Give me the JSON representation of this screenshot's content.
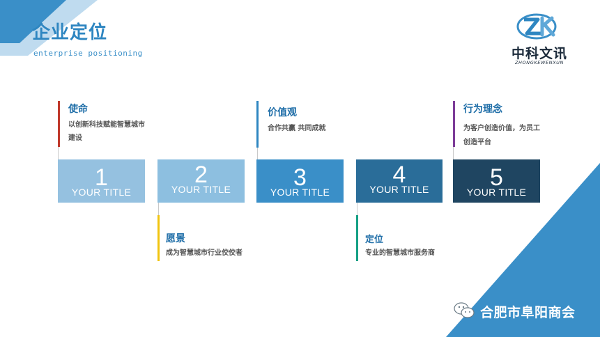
{
  "header": {
    "title": "企业定位",
    "subtitle": "enterprise positioning"
  },
  "logo": {
    "name_cn": "中科文讯",
    "name_en": "ZHONGKEWENXUN",
    "icon": "zk-logo-icon"
  },
  "boxes": [
    {
      "number": "1",
      "label": "YOUR TITLE",
      "color": "#95c1e0"
    },
    {
      "number": "2",
      "label": "YOUR TITLE",
      "color": "#8dbfe0"
    },
    {
      "number": "3",
      "label": "YOUR TITLE",
      "color": "#3a8fc8"
    },
    {
      "number": "4",
      "label": "YOUR TITLE",
      "color": "#2a6d99"
    },
    {
      "number": "5",
      "label": "YOUR TITLE",
      "color": "#1f4561"
    }
  ],
  "annotations": {
    "mission": {
      "title": "使命",
      "desc_line1": "以创新科技赋能智慧城市",
      "desc_line2": "建设",
      "accent": "#c0392b"
    },
    "vision": {
      "title": "愿景",
      "desc": "成为智慧城市行业佼佼者",
      "accent": "#f1c40f"
    },
    "values": {
      "title": "价值观",
      "desc": "合作共赢 共同成就",
      "accent": "#2e86c1"
    },
    "positioning": {
      "title": "定位",
      "desc": "专业的智慧城市服务商",
      "accent": "#16a085"
    },
    "conduct": {
      "title": "行为理念",
      "desc_line1": "为客户创造价值，为员工",
      "desc_line2": "创造平台",
      "accent": "#7d3c98"
    }
  },
  "footer": {
    "org_name": "合肥市阜阳商会",
    "icon": "wechat-icon"
  },
  "theme": {
    "primary": "#2e86c1",
    "corner": "#3a8fc8",
    "corner_light": "#a9cfe9"
  }
}
